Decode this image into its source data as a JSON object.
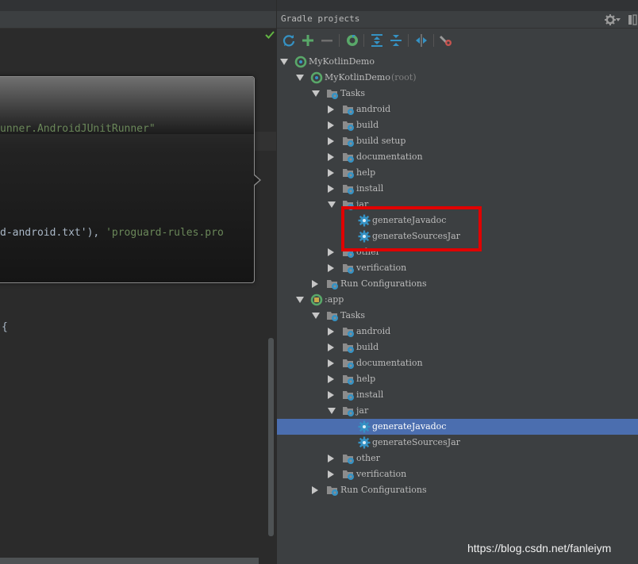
{
  "editor": {
    "line1": "unner.AndroidJUnitRunner\"",
    "line2_prefix": "d-android.txt'), ",
    "line2_string": "'proguard-rules.pro",
    "line3": "{"
  },
  "gradle_panel": {
    "title": "Gradle projects",
    "toolbar": {
      "refresh": "refresh-icon",
      "add": "add-icon",
      "remove": "remove-icon",
      "execute": "execute-gradle-task-icon",
      "expand_all": "expand-all-icon",
      "collapse_all": "collapse-all-icon",
      "toggle_offline": "toggle-offline-icon",
      "gradle_settings": "gradle-settings-icon"
    },
    "tree": [
      {
        "label": "MyKotlinDemo"
      },
      {
        "label": "MyKotlinDemo",
        "sub": "(root)"
      },
      {
        "label": "Tasks"
      },
      {
        "label": "android"
      },
      {
        "label": "build"
      },
      {
        "label": "build setup"
      },
      {
        "label": "documentation"
      },
      {
        "label": "help"
      },
      {
        "label": "install"
      },
      {
        "label": "jar"
      },
      {
        "label": "generateJavadoc"
      },
      {
        "label": "generateSourcesJar"
      },
      {
        "label": "other"
      },
      {
        "label": "verification"
      },
      {
        "label": "Run Configurations"
      },
      {
        "label": ":app"
      },
      {
        "label": "Tasks"
      },
      {
        "label": "android"
      },
      {
        "label": "build"
      },
      {
        "label": "documentation"
      },
      {
        "label": "help"
      },
      {
        "label": "install"
      },
      {
        "label": "jar"
      },
      {
        "label": "generateJavadoc"
      },
      {
        "label": "generateSourcesJar"
      },
      {
        "label": "other"
      },
      {
        "label": "verification"
      },
      {
        "label": "Run Configurations"
      }
    ]
  },
  "colors": {
    "selection": "#4b6eaf",
    "highlight_box": "#e00000",
    "gear_blue": "#3592c4"
  },
  "watermark": "https://blog.csdn.net/fanleiym"
}
